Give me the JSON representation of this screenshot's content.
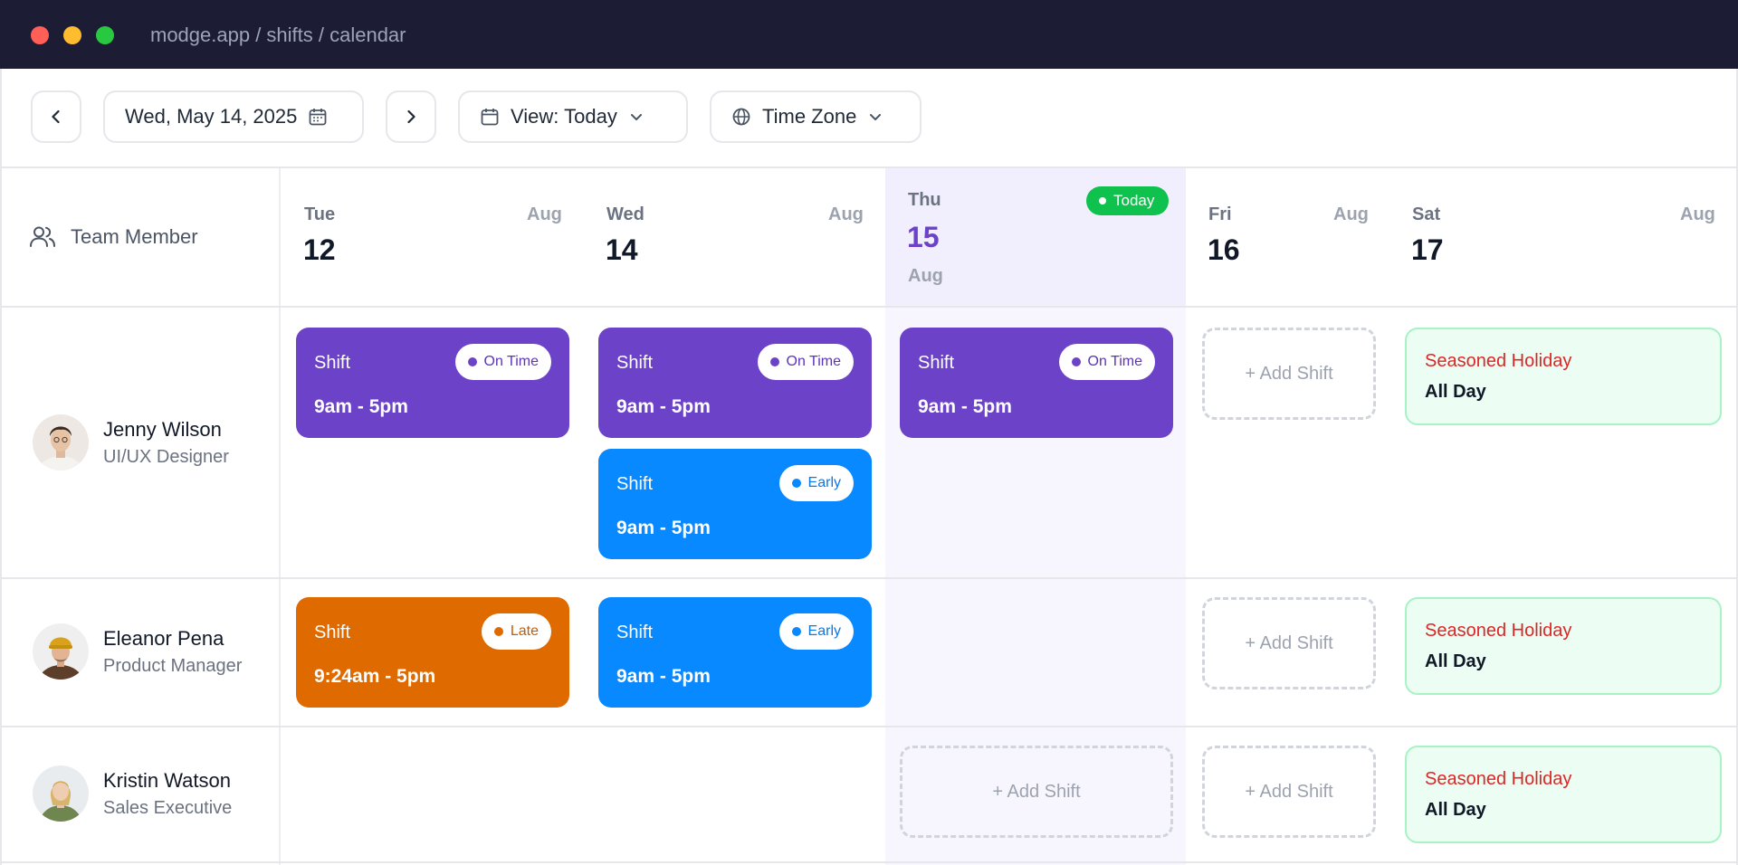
{
  "window": {
    "url": "modge.app / shifts / calendar"
  },
  "toolbar": {
    "date_label": "Wed, May 14, 2025",
    "view_label": "View: Today",
    "timezone_label": "Time Zone"
  },
  "grid": {
    "member_header": "Team Member",
    "today_badge": "Today",
    "days": [
      {
        "name": "Tue",
        "number": "12",
        "month": "Aug",
        "is_today": false
      },
      {
        "name": "Wed",
        "number": "14",
        "month": "Aug",
        "is_today": false
      },
      {
        "name": "Thu",
        "number": "15",
        "month": "Aug",
        "is_today": true
      },
      {
        "name": "Fri",
        "number": "16",
        "month": "Aug",
        "is_today": false
      },
      {
        "name": "Sat",
        "number": "17",
        "month": "Aug",
        "is_today": false
      }
    ]
  },
  "members": [
    {
      "name": "Jenny Wilson",
      "role": "UI/UX Designer"
    },
    {
      "name": "Eleanor Pena",
      "role": "Product Manager"
    },
    {
      "name": "Kristin Watson",
      "role": "Sales Executive"
    }
  ],
  "shifts": {
    "r1_tue": {
      "label": "Shift",
      "time": "9am - 5pm",
      "status": "On Time",
      "color": "#6b42c8"
    },
    "r1_wed_a": {
      "label": "Shift",
      "time": "9am - 5pm",
      "status": "On Time",
      "color": "#6b42c8"
    },
    "r1_wed_b": {
      "label": "Shift",
      "time": "9am - 5pm",
      "status": "Early",
      "color": "#0889ff"
    },
    "r1_thu": {
      "label": "Shift",
      "time": "9am - 5pm",
      "status": "On Time",
      "color": "#6b42c8"
    },
    "r2_tue": {
      "label": "Shift",
      "time": "9:24am - 5pm",
      "status": "Late",
      "color": "#de6a00"
    },
    "r2_wed": {
      "label": "Shift",
      "time": "9am - 5pm",
      "status": "Early",
      "color": "#0889ff"
    }
  },
  "add_shift_label": "+ Add Shift",
  "holiday": {
    "title": "Seasoned Holiday",
    "subtitle": "All Day"
  }
}
